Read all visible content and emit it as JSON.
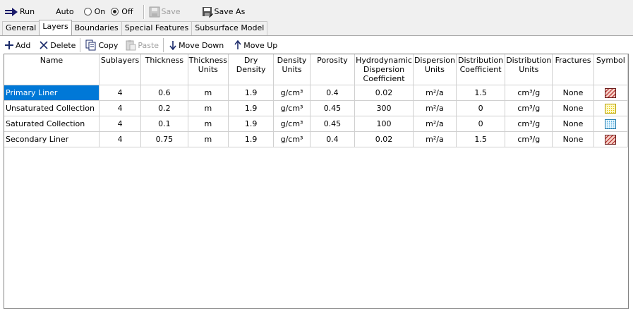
{
  "toolbar": {
    "run": "Run",
    "auto": "Auto",
    "on": "On",
    "off": "Off",
    "save": "Save",
    "save_as": "Save As"
  },
  "tabs": [
    {
      "label": "General",
      "active": false
    },
    {
      "label": "Layers",
      "active": true
    },
    {
      "label": "Boundaries",
      "active": false
    },
    {
      "label": "Special Features",
      "active": false
    },
    {
      "label": "Subsurface Model",
      "active": false
    }
  ],
  "layers_toolbar": {
    "add": "Add",
    "delete": "Delete",
    "copy": "Copy",
    "paste": "Paste",
    "move_down": "Move Down",
    "move_up": "Move Up"
  },
  "columns": {
    "name": "Name",
    "sublayers": "Sublayers",
    "thickness": "Thickness",
    "thickness_units_1": "Thickness",
    "thickness_units_2": "Units",
    "dry_density": "Dry Density",
    "density_units_1": "Density",
    "density_units_2": "Units",
    "porosity": "Porosity",
    "hydro_1": "Hydrodynamic",
    "hydro_2": "Dispersion",
    "hydro_3": "Coefficient",
    "disp_units_1": "Dispersion",
    "disp_units_2": "Units",
    "dist_coef_1": "Distribution",
    "dist_coef_2": "Coefficient",
    "dist_units_1": "Distribution",
    "dist_units_2": "Units",
    "fractures": "Fractures",
    "symbol": "Symbol"
  },
  "rows": [
    {
      "name": "Primary Liner",
      "sublayers": "4",
      "thickness": "0.6",
      "thickness_units": "m",
      "dry_density": "1.9",
      "density_units": "g/cm³",
      "porosity": "0.4",
      "hydro": "0.02",
      "disp_units": "m²/a",
      "dist_coef": "1.5",
      "dist_units": "cm³/g",
      "fractures": "None",
      "symbol": "red-hatch-icon"
    },
    {
      "name": "Unsaturated Collection",
      "sublayers": "4",
      "thickness": "0.2",
      "thickness_units": "m",
      "dry_density": "1.9",
      "density_units": "g/cm³",
      "porosity": "0.45",
      "hydro": "300",
      "disp_units": "m²/a",
      "dist_coef": "0",
      "dist_units": "cm³/g",
      "fractures": "None",
      "symbol": "yellow-dots-icon"
    },
    {
      "name": "Saturated Collection",
      "sublayers": "4",
      "thickness": "0.1",
      "thickness_units": "m",
      "dry_density": "1.9",
      "density_units": "g/cm³",
      "porosity": "0.45",
      "hydro": "100",
      "disp_units": "m²/a",
      "dist_coef": "0",
      "dist_units": "cm³/g",
      "fractures": "None",
      "symbol": "blue-dots-icon"
    },
    {
      "name": "Secondary Liner",
      "sublayers": "4",
      "thickness": "0.75",
      "thickness_units": "m",
      "dry_density": "1.9",
      "density_units": "g/cm³",
      "porosity": "0.4",
      "hydro": "0.02",
      "disp_units": "m²/a",
      "dist_coef": "1.5",
      "dist_units": "cm³/g",
      "fractures": "None",
      "symbol": "red-hatch-icon"
    }
  ],
  "selected_row": 0,
  "colors": {
    "selection": "#0078d7",
    "hatch_red": "#b02020",
    "dots_yellow": "#e6d200",
    "dots_blue": "#3aa0d8"
  }
}
